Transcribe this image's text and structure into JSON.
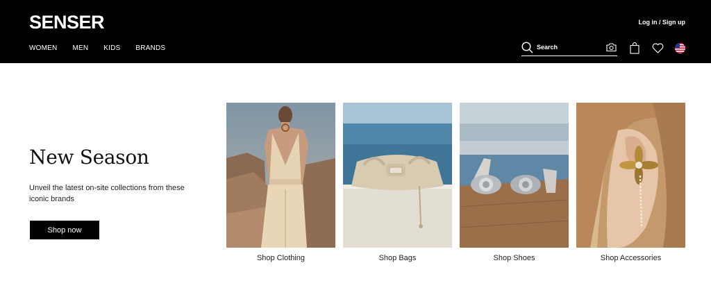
{
  "brand": {
    "logo_text": "SENSER"
  },
  "header": {
    "login_label": "Log in / Sign up",
    "nav": [
      {
        "label": "WOMEN"
      },
      {
        "label": "MEN"
      },
      {
        "label": "KIDS"
      },
      {
        "label": "BRANDS"
      }
    ],
    "search": {
      "placeholder": "Search",
      "icon": "search-icon"
    },
    "icons": [
      "camera-icon",
      "shopping-bag-icon",
      "heart-icon",
      "us-flag-icon"
    ]
  },
  "hero": {
    "title": "New Season",
    "subtitle": "Unveil the latest on-site collections from these iconic brands",
    "cta_label": "Shop now"
  },
  "categories": [
    {
      "label": "Shop Clothing",
      "image": "woman-in-cream-vest-and-trousers"
    },
    {
      "label": "Shop Bags",
      "image": "cream-leather-bag-by-the-sea"
    },
    {
      "label": "Shop Shoes",
      "image": "silver-flower-mules-on-wooden-deck"
    },
    {
      "label": "Shop Accessories",
      "image": "gold-flower-earring"
    }
  ],
  "colors": {
    "header_bg": "#000000",
    "text_on_header": "#ffffff",
    "button_bg": "#000000"
  }
}
